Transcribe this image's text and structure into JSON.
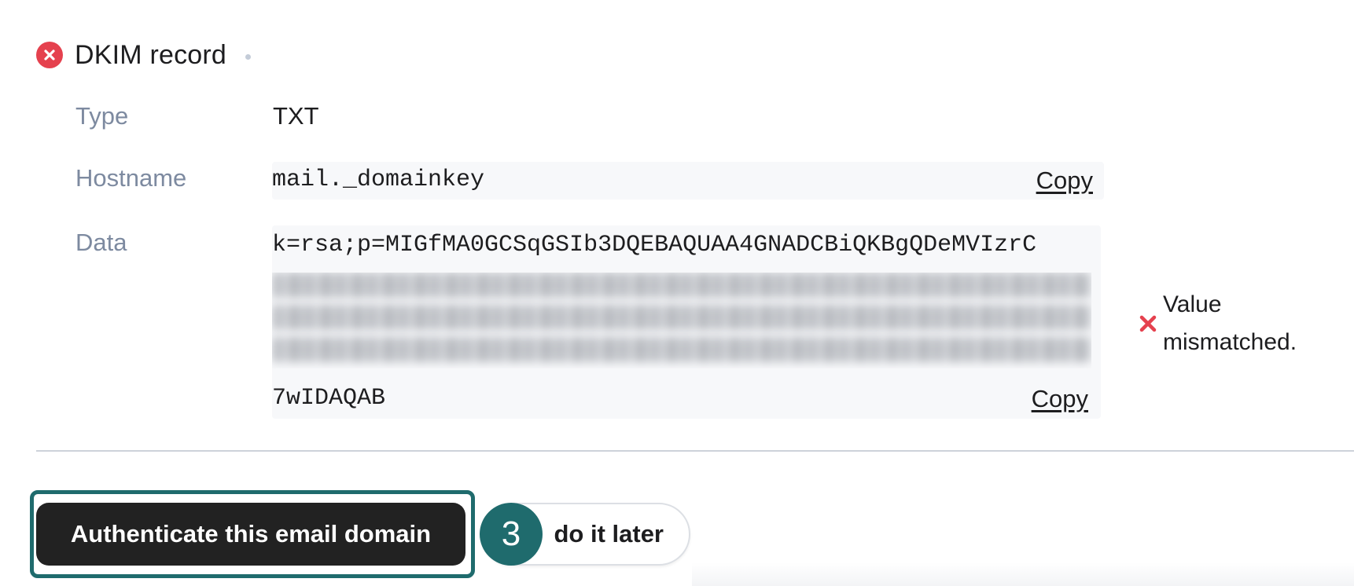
{
  "record": {
    "title": "DKIM record",
    "status_icon": "error-circle-icon",
    "status_color": "#e5414e"
  },
  "fields": {
    "type_label": "Type",
    "type_value": "TXT",
    "hostname_label": "Hostname",
    "hostname_value": "mail._domainkey",
    "hostname_copy": "Copy",
    "data_label": "Data",
    "data_value_first_line": "k=rsa;p=MIGfMA0GCSqGSIb3DQEBAQUAA4GNADCBiQKBgQDeMVIzrC",
    "data_value_last_line": "7wIDAQAB",
    "data_copy": "Copy"
  },
  "validation": {
    "icon": "x-icon",
    "message": "Value mismatched.",
    "color": "#e5414e"
  },
  "actions": {
    "authenticate_label": "Authenticate this email domain",
    "later_label": "do it later",
    "step_number": "3",
    "accent_color": "#1f6b6d"
  }
}
